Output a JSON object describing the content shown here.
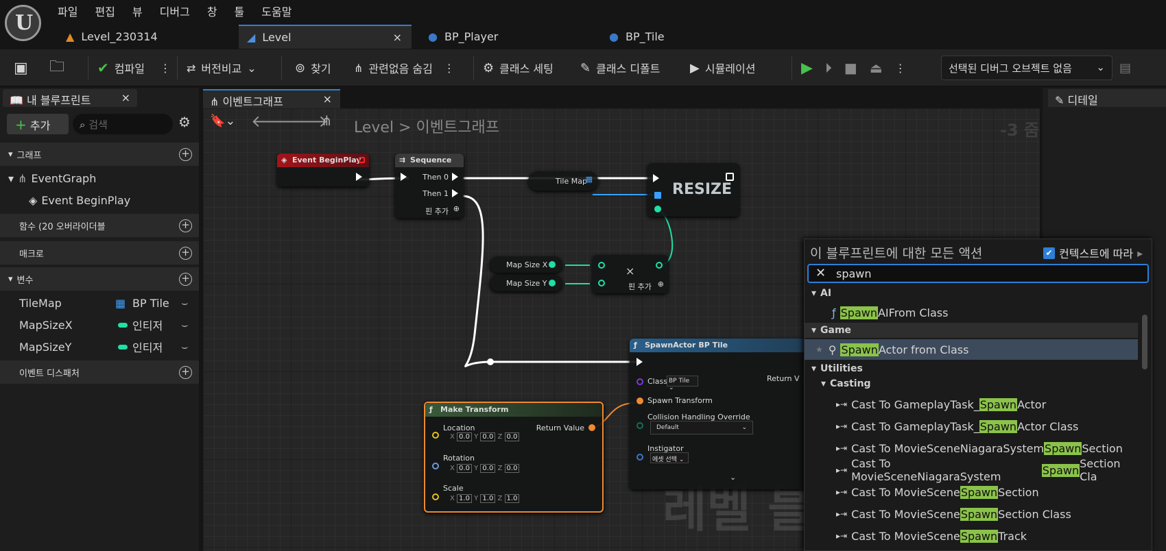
{
  "menu": [
    "파일",
    "편집",
    "뷰",
    "디버그",
    "창",
    "툴",
    "도움말"
  ],
  "tabs": [
    {
      "label": "Level_230314"
    },
    {
      "label": "Level",
      "close": "×"
    },
    {
      "label": "BP_Player"
    },
    {
      "label": "BP_Tile"
    }
  ],
  "toolbar": {
    "compile": "컴파일",
    "diff": "버전비교",
    "find": "찾기",
    "hide_unrelated": "관련없음 숨김",
    "class_settings": "클래스 세팅",
    "class_defaults": "클래스 디폴트",
    "simulation": "시뮬레이션",
    "debug_object": "선택된 디버그 오브젝트 없음"
  },
  "my_blueprint": {
    "title": "내 블루프린트",
    "close": "×",
    "add": "추가",
    "search_placeholder": "검색",
    "graphs": "그래프",
    "event_graph": "EventGraph",
    "event_begin_play": "Event BeginPlay",
    "functions": "함수 (20 오버라이더블",
    "macros": "매크로",
    "variables": "변수",
    "dispatchers": "이벤트 디스패처",
    "vars": [
      {
        "name": "TileMap",
        "type": "BP Tile",
        "color": "#3aa0ff"
      },
      {
        "name": "MapSizeX",
        "type": "인티저",
        "color": "#1fe0a5"
      },
      {
        "name": "MapSizeY",
        "type": "인티저",
        "color": "#1fe0a5"
      }
    ]
  },
  "graph": {
    "tab": "이벤트그래프",
    "close": "×",
    "crumb_root": "Level",
    "crumb_sep": ">",
    "crumb_leaf": "이벤트그래프",
    "zoom": "-3 줌",
    "watermark": "레벨 블",
    "nodes": {
      "begin_play": "Event BeginPlay",
      "sequence": "Sequence",
      "then0": "Then 0",
      "then1": "Then 1",
      "add_pin": "핀 추가",
      "tilemap": "Tile Map",
      "resize": "RESIZE",
      "mapx": "Map Size X",
      "mapy": "Map Size Y",
      "mult": "×",
      "spawn": "SpawnActor BP Tile",
      "class": "Class",
      "class_val": "BP Tile",
      "spawn_transform": "Spawn Transform",
      "collision": "Collision Handling Override",
      "collision_val": "Default",
      "instigator": "Instigator",
      "instigator_val": "에셋 선택",
      "return_v": "Return V",
      "make_transform": "Make Transform",
      "location": "Location",
      "rotation": "Rotation",
      "scale": "Scale",
      "return_value": "Return Value",
      "loc": [
        "0.0",
        "0.0",
        "0.0"
      ],
      "rot": [
        "0.0",
        "0.0",
        "0.0"
      ],
      "scl": [
        "1.0",
        "1.0",
        "1.0"
      ]
    }
  },
  "details": {
    "title": "디테일"
  },
  "actions": {
    "title": "이 블루프린트에 대한 모든 액션",
    "context": "컨텍스트에 따라",
    "search_value": "spawn",
    "cat_ai": "AI",
    "cat_game": "Game",
    "cat_util": "Utilities",
    "cat_casting": "Casting",
    "ai_item": {
      "hl": "Spawn",
      "rest": " AIFrom Class"
    },
    "game_item": {
      "hl": "Spawn",
      "rest": " Actor from Class"
    },
    "casting": [
      {
        "pre": "Cast To GameplayTask_",
        "hl": "Spawn",
        "post": "Actor"
      },
      {
        "pre": "Cast To GameplayTask_",
        "hl": "Spawn",
        "post": "Actor Class"
      },
      {
        "pre": "Cast To MovieSceneNiagaraSystem",
        "hl": "Spawn",
        "post": "Section"
      },
      {
        "pre": "Cast To MovieSceneNiagaraSystem",
        "hl": "Spawn",
        "post": "Section Cla"
      },
      {
        "pre": "Cast To MovieScene",
        "hl": "Spawn",
        "post": "Section"
      },
      {
        "pre": "Cast To MovieScene",
        "hl": "Spawn",
        "post": "Section Class"
      },
      {
        "pre": "Cast To MovieScene",
        "hl": "Spawn",
        "post": "Track"
      }
    ]
  }
}
